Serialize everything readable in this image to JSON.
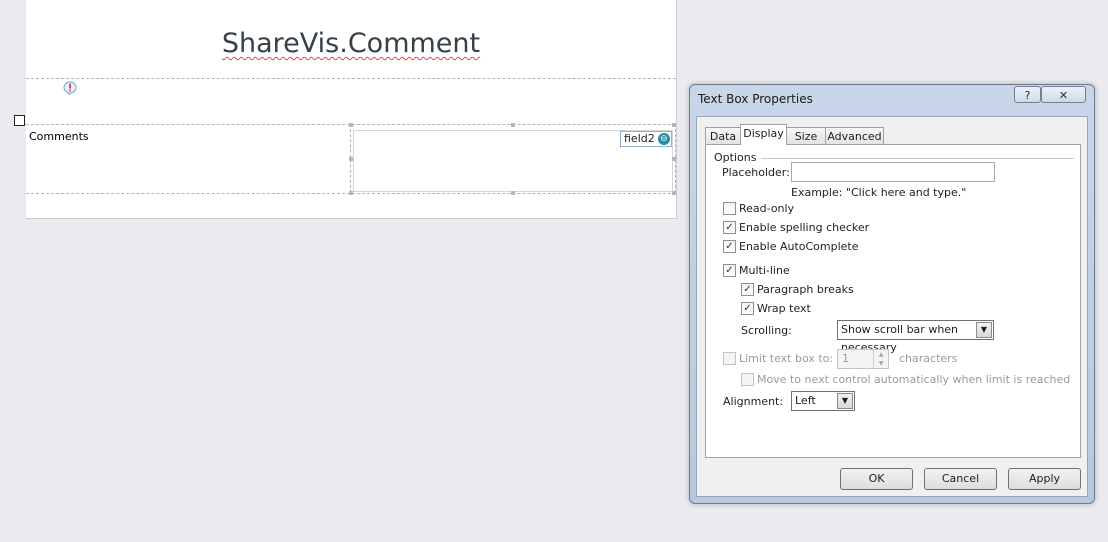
{
  "form": {
    "title": "ShareVis.Comment",
    "comments_label": "Comments",
    "field_tag": "field2"
  },
  "dialog": {
    "title": "Text Box Properties",
    "help_label": "?",
    "close_label": "✕",
    "tabs": [
      "Data",
      "Display",
      "Size",
      "Advanced"
    ],
    "active_tab": "Display",
    "options_label": "Options",
    "placeholder_label": "Placeholder:",
    "placeholder_value": "",
    "placeholder_example": "Example: \"Click here and type.\"",
    "read_only": {
      "label": "Read-only",
      "checked": false
    },
    "spelling": {
      "label": "Enable spelling checker",
      "checked": true
    },
    "autocomplete": {
      "label": "Enable AutoComplete",
      "checked": true
    },
    "multiline": {
      "label": "Multi-line",
      "checked": true
    },
    "paragraph_breaks": {
      "label": "Paragraph breaks",
      "checked": true
    },
    "wrap_text": {
      "label": "Wrap text",
      "checked": true
    },
    "scrolling_label": "Scrolling:",
    "scrolling_value": "Show scroll bar when necessary",
    "limit_label": "Limit text box to:",
    "limit_value": "1",
    "limit_unit": "characters",
    "move_next_label": "Move to next control automatically when limit is reached",
    "alignment_label": "Alignment:",
    "alignment_value": "Left",
    "ok_label": "OK",
    "cancel_label": "Cancel",
    "apply_label": "Apply"
  }
}
